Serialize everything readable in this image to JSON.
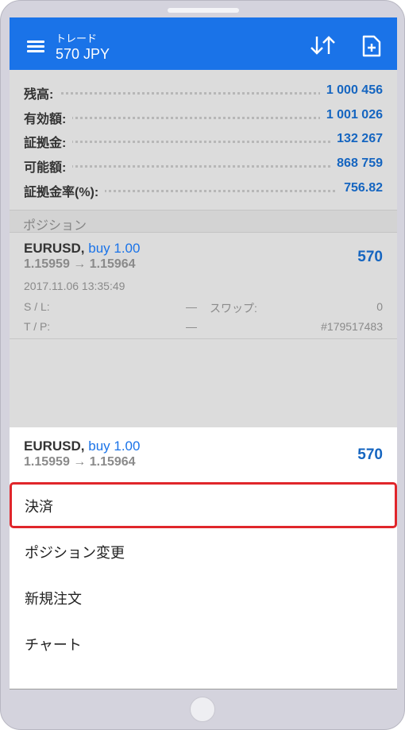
{
  "header": {
    "title_small": "トレード",
    "title_big": "570 JPY"
  },
  "summary": [
    {
      "label": "残高:",
      "value": "1 000 456"
    },
    {
      "label": "有効額:",
      "value": "1 001 026"
    },
    {
      "label": "証拠金:",
      "value": "132 267"
    },
    {
      "label": "可能額:",
      "value": "868 759"
    },
    {
      "label": "証拠金率(%):",
      "value": "756.82"
    }
  ],
  "section": {
    "title": "ポジション"
  },
  "position": {
    "symbol": "EURUSD,",
    "side": "buy 1.00",
    "prices": "1.15959 → 1.15964",
    "profit": "570",
    "time": "2017.11.06 13:35:49",
    "sl_label": "S / L:",
    "sl_value": "—",
    "swap_label": "スワップ:",
    "swap_value": "0",
    "tp_label": "T / P:",
    "tp_value": "—",
    "ticket": "#179517483"
  },
  "sheet": {
    "symbol": "EURUSD,",
    "side": "buy 1.00",
    "prices": "1.15959 → 1.15964",
    "profit": "570",
    "items": [
      {
        "label": "決済"
      },
      {
        "label": "ポジション変更"
      },
      {
        "label": "新規注文"
      },
      {
        "label": "チャート"
      }
    ]
  },
  "colors": {
    "topbar": "#1a73e8",
    "value_blue": "#1565c0",
    "highlight": "#e0262b"
  }
}
